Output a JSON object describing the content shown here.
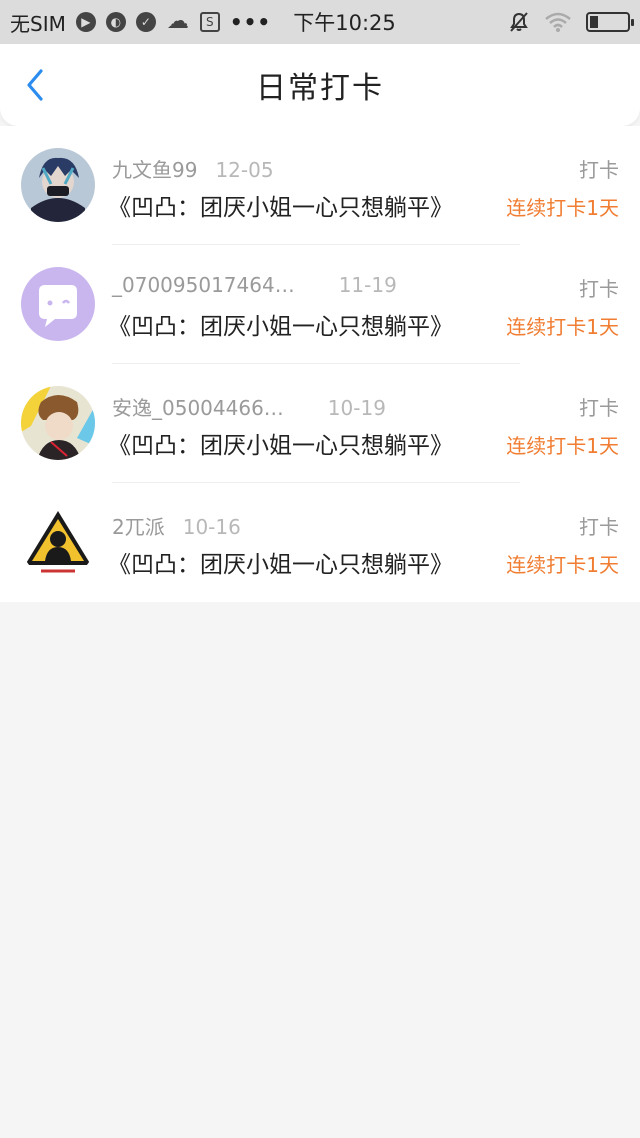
{
  "status_bar": {
    "carrier": "无SIM",
    "dots": "•••",
    "time": "下午10:25"
  },
  "header": {
    "title": "日常打卡"
  },
  "colors": {
    "accent_blue": "#2b8cf0",
    "streak_orange": "#f07d32"
  },
  "items": [
    {
      "name": "九文鱼99",
      "date": "12-05",
      "book": "《凹凸：团厌小姐一心只想躺平》",
      "type": "打卡",
      "streak": "连续打卡1天"
    },
    {
      "name": "_070095017464…",
      "date": "11-19",
      "book": "《凹凸：团厌小姐一心只想躺平》",
      "type": "打卡",
      "streak": "连续打卡1天"
    },
    {
      "name": "安逸_05004466…",
      "date": "10-19",
      "book": "《凹凸：团厌小姐一心只想躺平》",
      "type": "打卡",
      "streak": "连续打卡1天"
    },
    {
      "name": "2兀派",
      "date": "10-16",
      "book": "《凹凸：团厌小姐一心只想躺平》",
      "type": "打卡",
      "streak": "连续打卡1天"
    }
  ]
}
